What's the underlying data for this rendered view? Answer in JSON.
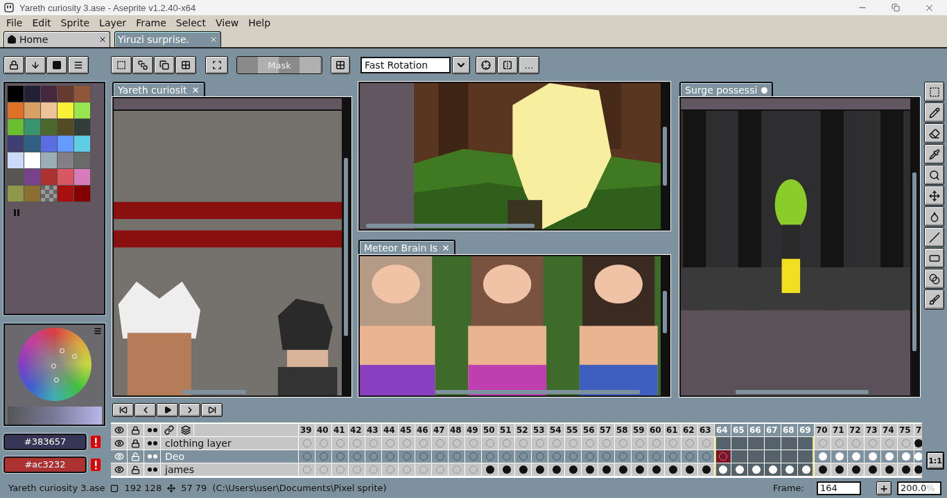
{
  "window": {
    "title": "Yareth curiosity 3.ase - Aseprite v1.2.40-x64"
  },
  "menu": [
    "File",
    "Edit",
    "Sprite",
    "Layer",
    "Frame",
    "Select",
    "View",
    "Help"
  ],
  "tabs": [
    {
      "kind": "home",
      "label": "Home",
      "selected": false
    },
    {
      "kind": "file",
      "label": "Yiruzi surprise.",
      "selected": true
    }
  ],
  "toolbar": {
    "mask_label": "Mask",
    "rotation": "Fast Rotation",
    "more_label": "…"
  },
  "palette": [
    {
      "color": "#000000"
    },
    {
      "color": "#222034"
    },
    {
      "color": "#45283c"
    },
    {
      "color": "#663931"
    },
    {
      "color": "#8f563b"
    },
    {
      "color": "#df7126"
    },
    {
      "color": "#d9a066"
    },
    {
      "color": "#eec39a"
    },
    {
      "color": "#fbf236"
    },
    {
      "color": "#99e550"
    },
    {
      "color": "#6abe30"
    },
    {
      "color": "#37946e"
    },
    {
      "color": "#4b692f"
    },
    {
      "color": "#524b24"
    },
    {
      "color": "#323c39"
    },
    {
      "color": "#3f3f74"
    },
    {
      "color": "#306082"
    },
    {
      "color": "#5b6ee1"
    },
    {
      "color": "#639bff"
    },
    {
      "color": "#5fcde4"
    },
    {
      "color": "#cbdbfc"
    },
    {
      "color": "#ffffff"
    },
    {
      "color": "#9badb7"
    },
    {
      "color": "#847e87"
    },
    {
      "color": "#696a6a"
    },
    {
      "color": "#595652"
    },
    {
      "color": "#76428a"
    },
    {
      "color": "#ac3232"
    },
    {
      "color": "#d95763"
    },
    {
      "color": "#d77bba"
    },
    {
      "color": "#8f974a"
    },
    {
      "color": "#8a6f30"
    },
    {
      "kind": "transparent"
    },
    {
      "color": "#a81010"
    },
    {
      "color": "#850000"
    }
  ],
  "colors": {
    "foreground": {
      "value": "#383657",
      "color": "#383657"
    },
    "background": {
      "value": "#ac3232",
      "color": "#ac3232"
    }
  },
  "editors": [
    {
      "kind": "picture",
      "title": "Yareth curiosit",
      "modified": false
    },
    {
      "kind": "picture"
    },
    {
      "kind": "picture",
      "title": "Meteor Brain Is",
      "modified": false
    },
    {
      "kind": "picture",
      "title": "Surge possessi",
      "modified": true
    }
  ],
  "timeline": {
    "frames": [
      {
        "label": "39",
        "selected": false
      },
      {
        "label": "40",
        "selected": false
      },
      {
        "label": "41",
        "selected": false
      },
      {
        "label": "42",
        "selected": false
      },
      {
        "label": "43",
        "selected": false
      },
      {
        "label": "44",
        "selected": false
      },
      {
        "label": "45",
        "selected": false
      },
      {
        "label": "46",
        "selected": false
      },
      {
        "label": "47",
        "selected": false
      },
      {
        "label": "48",
        "selected": false
      },
      {
        "label": "49",
        "selected": false
      },
      {
        "label": "50",
        "selected": false
      },
      {
        "label": "51",
        "selected": false
      },
      {
        "label": "52",
        "selected": false
      },
      {
        "label": "53",
        "selected": false
      },
      {
        "label": "54",
        "selected": false
      },
      {
        "label": "55",
        "selected": false
      },
      {
        "label": "56",
        "selected": false
      },
      {
        "label": "57",
        "selected": false
      },
      {
        "label": "58",
        "selected": false
      },
      {
        "label": "59",
        "selected": false
      },
      {
        "label": "60",
        "selected": false
      },
      {
        "label": "61",
        "selected": false
      },
      {
        "label": "62",
        "selected": false
      },
      {
        "label": "63",
        "selected": false
      },
      {
        "label": "64",
        "selected": true
      },
      {
        "label": "65",
        "selected": true
      },
      {
        "label": "66",
        "selected": true
      },
      {
        "label": "67",
        "selected": true
      },
      {
        "label": "68",
        "selected": true
      },
      {
        "label": "69",
        "selected": true
      },
      {
        "label": "70",
        "selected": false
      },
      {
        "label": "71",
        "selected": false
      },
      {
        "label": "72",
        "selected": false
      },
      {
        "label": "73",
        "selected": false
      },
      {
        "label": "74",
        "selected": false
      },
      {
        "label": "75",
        "selected": false
      },
      {
        "label": "7",
        "selected": false
      }
    ],
    "layers": [
      {
        "name": "clothing layer",
        "visible": true,
        "locked": true,
        "selected": false,
        "cels": [
          {
            "kind": "empty"
          },
          {
            "kind": "empty"
          },
          {
            "kind": "empty"
          },
          {
            "kind": "empty"
          },
          {
            "kind": "empty"
          },
          {
            "kind": "empty"
          },
          {
            "kind": "empty"
          },
          {
            "kind": "empty"
          },
          {
            "kind": "empty"
          },
          {
            "kind": "empty"
          },
          {
            "kind": "empty"
          },
          {
            "kind": "empty"
          },
          {
            "kind": "empty"
          },
          {
            "kind": "empty"
          },
          {
            "kind": "empty"
          },
          {
            "kind": "empty"
          },
          {
            "kind": "empty"
          },
          {
            "kind": "empty"
          },
          {
            "kind": "empty"
          },
          {
            "kind": "empty"
          },
          {
            "kind": "empty"
          },
          {
            "kind": "empty"
          },
          {
            "kind": "empty"
          },
          {
            "kind": "empty"
          },
          {
            "kind": "empty"
          },
          {
            "kind": "none"
          },
          {
            "kind": "none"
          },
          {
            "kind": "none"
          },
          {
            "kind": "none"
          },
          {
            "kind": "none"
          },
          {
            "kind": "none"
          },
          {
            "kind": "empty"
          },
          {
            "kind": "empty"
          },
          {
            "kind": "empty"
          },
          {
            "kind": "empty"
          },
          {
            "kind": "empty"
          },
          {
            "kind": "empty"
          },
          {
            "kind": "full"
          }
        ]
      },
      {
        "name": "Deo",
        "visible": true,
        "locked": false,
        "selected": true,
        "cels": [
          {
            "kind": "empty"
          },
          {
            "kind": "empty"
          },
          {
            "kind": "empty"
          },
          {
            "kind": "empty"
          },
          {
            "kind": "empty"
          },
          {
            "kind": "empty"
          },
          {
            "kind": "empty"
          },
          {
            "kind": "empty"
          },
          {
            "kind": "empty"
          },
          {
            "kind": "empty"
          },
          {
            "kind": "empty"
          },
          {
            "kind": "empty"
          },
          {
            "kind": "empty"
          },
          {
            "kind": "empty"
          },
          {
            "kind": "empty"
          },
          {
            "kind": "empty"
          },
          {
            "kind": "empty"
          },
          {
            "kind": "empty"
          },
          {
            "kind": "empty"
          },
          {
            "kind": "empty"
          },
          {
            "kind": "empty"
          },
          {
            "kind": "empty"
          },
          {
            "kind": "empty"
          },
          {
            "kind": "empty"
          },
          {
            "kind": "empty"
          },
          {
            "kind": "current"
          },
          {
            "kind": "none"
          },
          {
            "kind": "none"
          },
          {
            "kind": "none"
          },
          {
            "kind": "none"
          },
          {
            "kind": "none"
          },
          {
            "kind": "full"
          },
          {
            "kind": "full"
          },
          {
            "kind": "full"
          },
          {
            "kind": "full"
          },
          {
            "kind": "full"
          },
          {
            "kind": "full"
          },
          {
            "kind": "full"
          }
        ]
      },
      {
        "name": "james",
        "visible": true,
        "locked": false,
        "selected": false,
        "cels": [
          {
            "kind": "empty"
          },
          {
            "kind": "empty"
          },
          {
            "kind": "empty"
          },
          {
            "kind": "empty"
          },
          {
            "kind": "empty"
          },
          {
            "kind": "empty"
          },
          {
            "kind": "empty"
          },
          {
            "kind": "empty"
          },
          {
            "kind": "empty"
          },
          {
            "kind": "empty"
          },
          {
            "kind": "empty"
          },
          {
            "kind": "full"
          },
          {
            "kind": "full"
          },
          {
            "kind": "full"
          },
          {
            "kind": "full"
          },
          {
            "kind": "full"
          },
          {
            "kind": "full"
          },
          {
            "kind": "full"
          },
          {
            "kind": "full"
          },
          {
            "kind": "full"
          },
          {
            "kind": "full"
          },
          {
            "kind": "full"
          },
          {
            "kind": "full"
          },
          {
            "kind": "full"
          },
          {
            "kind": "full"
          },
          {
            "kind": "full"
          },
          {
            "kind": "full"
          },
          {
            "kind": "full"
          },
          {
            "kind": "full"
          },
          {
            "kind": "full"
          },
          {
            "kind": "full"
          },
          {
            "kind": "full"
          },
          {
            "kind": "full"
          },
          {
            "kind": "full"
          },
          {
            "kind": "full"
          },
          {
            "kind": "full"
          },
          {
            "kind": "full"
          },
          {
            "kind": "full"
          }
        ]
      }
    ]
  },
  "zoom_button": "1:1",
  "status": {
    "file": "Yareth curiosity 3.ase",
    "size": "192 128",
    "position": "57 79",
    "path": "(C:\\Users\\user\\Documents\\Pixel sprite)",
    "frame_label": "Frame:",
    "frame": "164",
    "add_label": "+",
    "zoom": "200.0",
    "zoom_unit": "%"
  }
}
